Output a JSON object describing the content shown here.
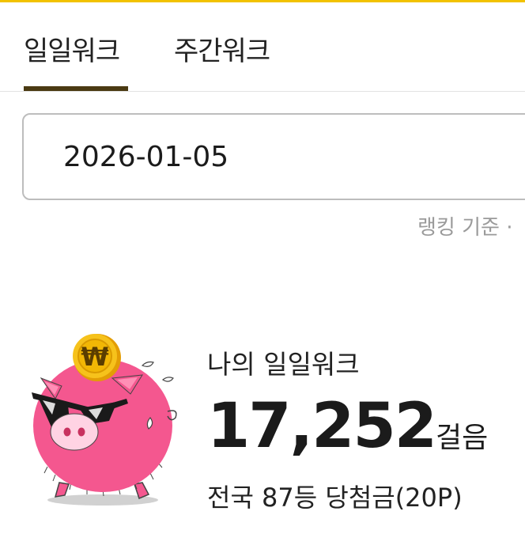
{
  "tabs": {
    "daily": "일일워크",
    "weekly": "주간워크"
  },
  "date_field": {
    "value": "2026-01-05"
  },
  "ranking_basis": "랭킹 기준 ·",
  "summary": {
    "label": "나의 일일워크",
    "steps": "17,252",
    "steps_unit": "걸음",
    "rank_text": "전국 87등 당첨금(20P)"
  },
  "coin_symbol": "₩",
  "icons": [
    "piggy-bank-mascot-icon",
    "won-coin-icon",
    "sunglasses-icon",
    "sweat-drop-icon"
  ],
  "colors": {
    "top_accent": "#f2c200",
    "tab_underline": "#4a3a12",
    "pig": "#f4578f",
    "coin": "#f2b705"
  }
}
